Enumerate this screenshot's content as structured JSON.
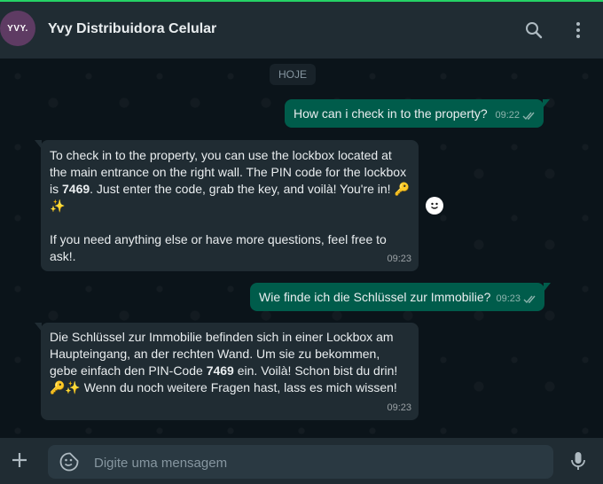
{
  "header": {
    "avatar_text": "YVY.",
    "title": "Yvy Distribuidora Celular",
    "icons": [
      "search-icon",
      "menu-dots-icon"
    ]
  },
  "chat": {
    "date_label": "HOJE",
    "messages": [
      {
        "dir": "out",
        "text": "How can i check in to the property?",
        "time": "09:22"
      },
      {
        "dir": "in",
        "p1a": "To check in to the property, you can use the lockbox located at the main entrance on the right wall. The PIN code for the lockbox is ",
        "pin": "7469",
        "p1b": ". Just enter the code, grab the key, and voilà! You're in! 🔑✨",
        "p2": "If you need anything else or have more questions, feel free to ask!.",
        "time": "09:23"
      },
      {
        "dir": "out",
        "text": "Wie finde ich die Schlüssel zur Immobilie?",
        "time": "09:23"
      },
      {
        "dir": "in",
        "pa": "Die Schlüssel zur Immobilie befinden sich in einer Lockbox am Haupteingang, an der rechten Wand. Um sie zu bekommen, gebe einfach den PIN-Code ",
        "pin": "7469",
        "pb": " ein. Voilà! Schon bist du drin! 🔑✨ Wenn du noch weitere Fragen hast, lass es mich wissen!",
        "time": "09:23"
      }
    ]
  },
  "footer": {
    "placeholder": "Digite uma mensagem",
    "icons": [
      "plus-icon",
      "sticker-icon",
      "mic-icon"
    ]
  },
  "colors": {
    "accent": "#25d366",
    "outgoing_bubble": "#005c4b",
    "incoming_bubble": "#202c33",
    "header_bg": "#202c33",
    "chat_bg": "#0b141a"
  }
}
